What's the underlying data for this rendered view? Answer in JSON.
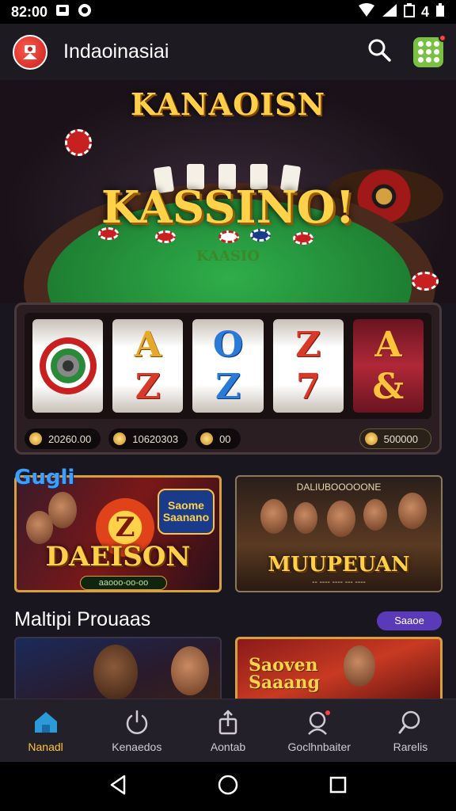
{
  "status_bar": {
    "time": "82:00",
    "battery": "4"
  },
  "app_bar": {
    "title": "Indaoinasiai",
    "icons": [
      "logo-icon",
      "search-icon",
      "apps-grid-icon"
    ],
    "accent": "#7ac043"
  },
  "hero": {
    "title_top": "KANAOISN",
    "title_main": "KASSINO!",
    "subtitle": "KAASIO"
  },
  "slot": {
    "credits": [
      "20260.00",
      "10620303",
      "00"
    ],
    "balance": "500000"
  },
  "promos": {
    "tag": "Gugli",
    "cards": [
      {
        "title": "DAEISON",
        "badge": "Saome Saanano",
        "pill": "aaooo-oo-oo",
        "symbol": "Z"
      },
      {
        "title": "MUUPEUAN",
        "caption": "DALIUBOOOOONE",
        "footer": "-- ---- ---- --- ----"
      }
    ]
  },
  "section": {
    "title": "Maltipi Prouaas",
    "action_label": "Saaoe",
    "action_color": "#5a3ab8"
  },
  "thumbs": [
    {
      "title": ""
    },
    {
      "title_line1": "Saoven",
      "title_line2": "Saaang"
    }
  ],
  "bottom_nav": {
    "items": [
      {
        "label": "Nanadl",
        "icon": "home-icon",
        "active": true
      },
      {
        "label": "Kenaedos",
        "icon": "power-icon",
        "active": false
      },
      {
        "label": "Aontab",
        "icon": "share-icon",
        "active": false
      },
      {
        "label": "Goclhnbaiter",
        "icon": "profile-icon",
        "active": false
      },
      {
        "label": "Rarelis",
        "icon": "search-icon",
        "active": false
      }
    ],
    "active_color": "#ffc43a"
  },
  "system_nav": [
    "back-icon",
    "home-circle-icon",
    "recents-icon"
  ]
}
